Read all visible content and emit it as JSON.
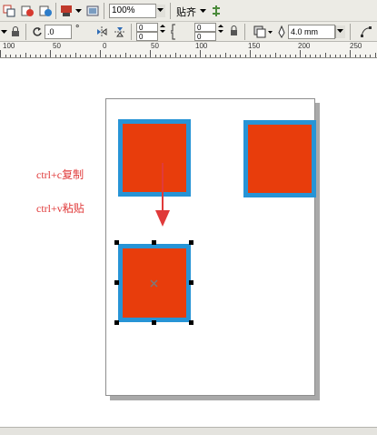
{
  "toolbar": {
    "zoom_value": "100%",
    "snap_label": "贴齐"
  },
  "property_bar": {
    "rotation_value": ".0",
    "degree_symbol": "°",
    "x_value_1": "0",
    "y_value_1": "0",
    "x_value_2": "0",
    "y_value_2": "0",
    "outline_width": "4.0 mm"
  },
  "ruler": {
    "labels": [
      "100",
      "50",
      "0",
      "50",
      "100",
      "150",
      "200",
      "250"
    ]
  },
  "annotations": {
    "copy_note": "ctrl+c复制",
    "paste_note": "ctrl+v粘贴"
  },
  "colors": {
    "square_fill": "#e83d0c",
    "square_outline": "#2794d6",
    "arrow": "#e03a3a",
    "note_text": "#e03a3a"
  },
  "icons": {
    "copy": "copy-icon",
    "import": "import-icon",
    "export": "export-icon",
    "app_launcher": "application-launcher-icon",
    "snap_options": "snap-options-icon",
    "lock": "lock-icon",
    "rotate": "rotate-icon",
    "mirror_h": "mirror-horizontal-icon",
    "mirror_v": "mirror-vertical-icon",
    "proportional_lock": "proportional-lock-icon",
    "wrap_text": "wrap-text-icon",
    "outline_pen": "outline-pen-icon",
    "convert_to_curves": "convert-to-curves-icon",
    "paste_arrow": "down-arrow-icon",
    "center_marker": "center-x-icon"
  }
}
